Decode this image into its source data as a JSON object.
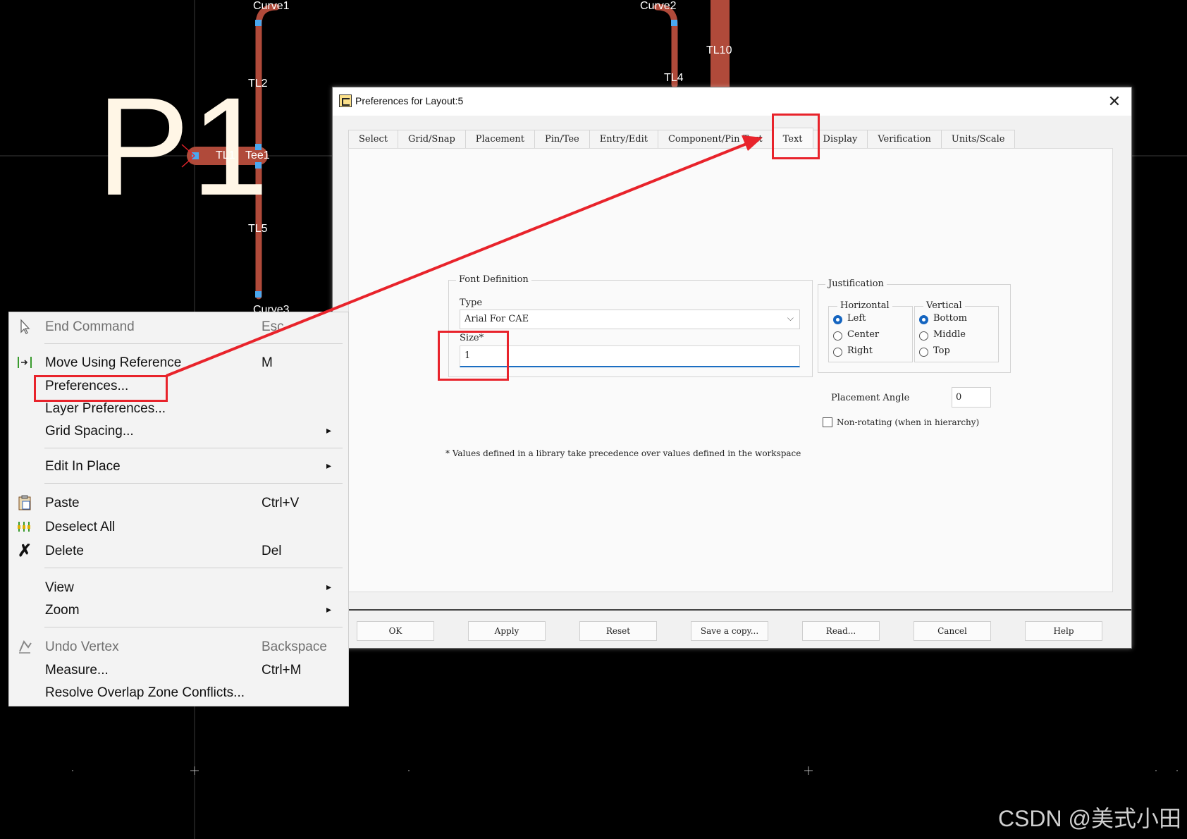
{
  "canvas": {
    "labels": {
      "curve1": "Curve1",
      "curve2": "Curve2",
      "curve3": "Curve3",
      "tl2": "TL2",
      "tl4": "TL4",
      "tl5": "TL5",
      "tl10": "TL10",
      "tl1": "TL1",
      "tee1": "Tee1"
    },
    "port_label": "P1",
    "trace_color": "#b04a3a",
    "pin_color": "#4aa8f0"
  },
  "dialog": {
    "title": "Preferences for Layout:5",
    "tabs": [
      "Select",
      "Grid/Snap",
      "Placement",
      "Pin/Tee",
      "Entry/Edit",
      "Component/Pin Text",
      "Text",
      "Display",
      "Verification",
      "Units/Scale"
    ],
    "active_tab": "Text",
    "font_definition": {
      "group_title": "Font Definition",
      "type_label": "Type",
      "type_value": "Arial For CAE",
      "size_label": "Size*",
      "size_value": "1"
    },
    "justification": {
      "group_title": "Justification",
      "horizontal": {
        "title": "Horizontal",
        "options": [
          "Left",
          "Center",
          "Right"
        ],
        "selected": "Left"
      },
      "vertical": {
        "title": "Vertical",
        "options": [
          "Bottom",
          "Middle",
          "Top"
        ],
        "selected": "Bottom"
      }
    },
    "placement_angle_label": "Placement Angle",
    "placement_angle_value": "0",
    "non_rotating_label": "Non-rotating (when in hierarchy)",
    "footnote": "* Values defined in a library take precedence over values defined in the workspace",
    "buttons": {
      "ok": "OK",
      "apply": "Apply",
      "reset": "Reset",
      "save_copy": "Save a copy...",
      "read": "Read...",
      "cancel": "Cancel",
      "help": "Help"
    }
  },
  "context_menu": {
    "end_command": {
      "label": "End Command",
      "shortcut": "Esc"
    },
    "move_using_reference": {
      "label": "Move Using Reference",
      "shortcut": "M"
    },
    "preferences": {
      "label": "Preferences..."
    },
    "layer_preferences": {
      "label": "Layer Preferences..."
    },
    "grid_spacing": {
      "label": "Grid Spacing..."
    },
    "edit_in_place": {
      "label": "Edit In Place"
    },
    "paste": {
      "label": "Paste",
      "shortcut": "Ctrl+V"
    },
    "deselect_all": {
      "label": "Deselect All"
    },
    "delete": {
      "label": "Delete",
      "shortcut": "Del"
    },
    "view": {
      "label": "View"
    },
    "zoom": {
      "label": "Zoom"
    },
    "undo_vertex": {
      "label": "Undo Vertex",
      "shortcut": "Backspace"
    },
    "measure": {
      "label": "Measure...",
      "shortcut": "Ctrl+M"
    },
    "resolve_overlap": {
      "label": "Resolve Overlap Zone Conflicts..."
    }
  },
  "annotation_color": "#e8232b",
  "watermark": "CSDN @美式小田"
}
